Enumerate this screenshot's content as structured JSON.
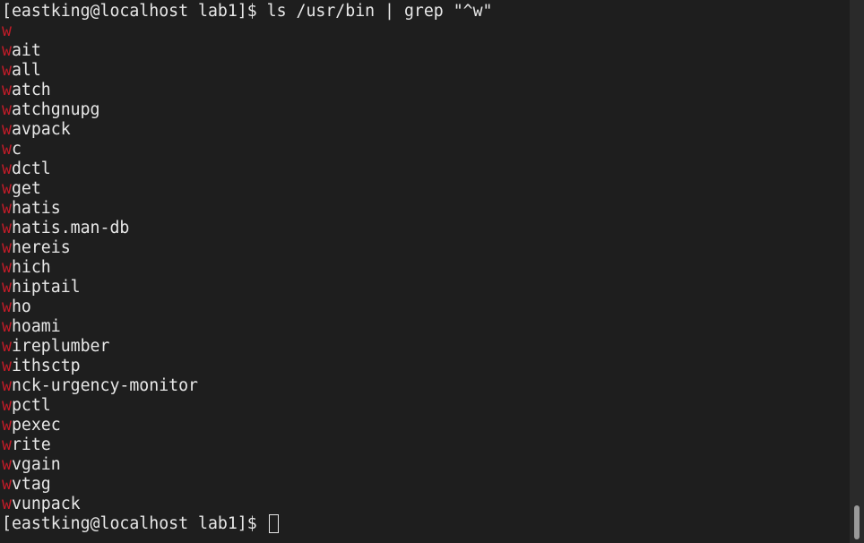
{
  "terminal": {
    "prompt": "[eastking@localhost lab1]$ ",
    "command": "ls /usr/bin | grep \"^w\"",
    "match_char": "w",
    "colors": {
      "background": "#1e1e1e",
      "text": "#e8e8e8",
      "match": "#c01c28"
    },
    "results": [
      "",
      "ait",
      "all",
      "atch",
      "atchgnupg",
      "avpack",
      "c",
      "dctl",
      "get",
      "hatis",
      "hatis.man-db",
      "hereis",
      "hich",
      "hiptail",
      "ho",
      "hoami",
      "ireplumber",
      "ithsctp",
      "nck-urgency-monitor",
      "pctl",
      "pexec",
      "rite",
      "vgain",
      "vtag",
      "vunpack"
    ],
    "scroll_position": 1.0
  }
}
